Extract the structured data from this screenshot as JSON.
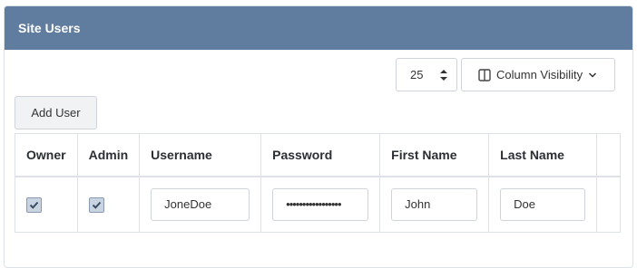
{
  "card": {
    "title": "Site Users"
  },
  "toolbar": {
    "page_length": "25",
    "column_visibility_label": "Column Visibility",
    "add_user_label": "Add User"
  },
  "table": {
    "headers": {
      "owner": "Owner",
      "admin": "Admin",
      "username": "Username",
      "password": "Password",
      "first_name": "First Name",
      "last_name": "Last Name"
    },
    "rows": [
      {
        "owner": true,
        "admin": true,
        "username": "JoneDoe",
        "password": "•••••••••••••••••",
        "first_name": "John",
        "last_name": "Doe"
      }
    ]
  }
}
